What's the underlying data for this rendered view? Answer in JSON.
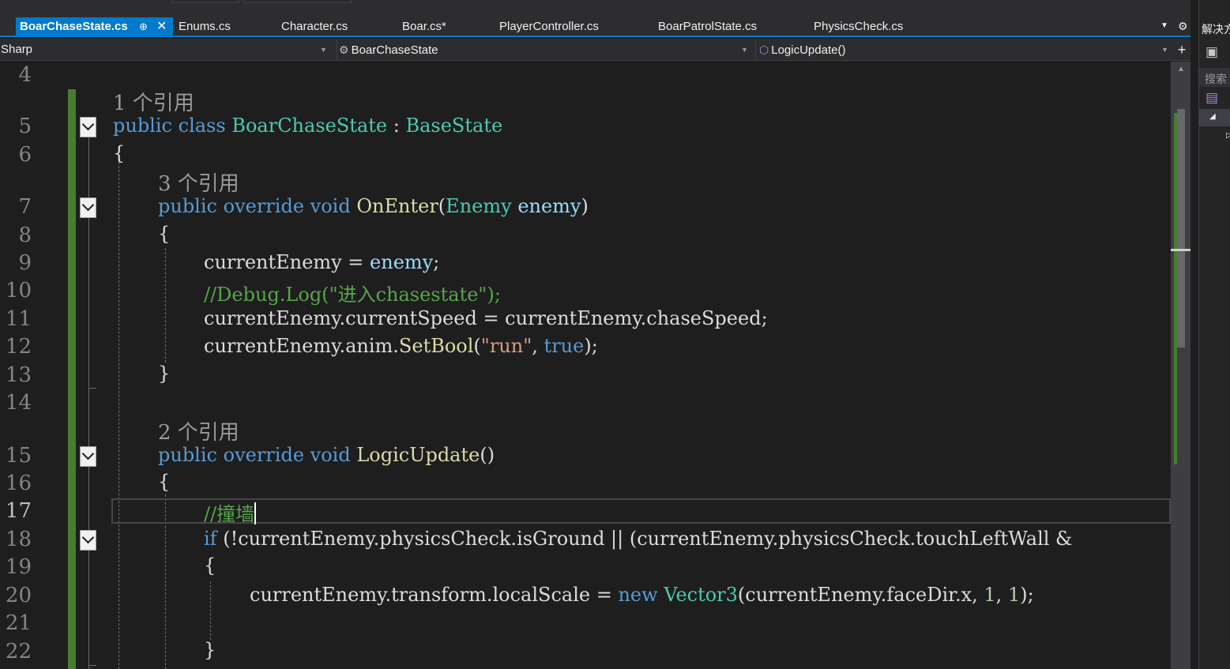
{
  "tabs": [
    {
      "label": "BoarChaseState.cs",
      "active": true
    },
    {
      "label": "Enums.cs"
    },
    {
      "label": "Character.cs"
    },
    {
      "label": "Boar.cs*"
    },
    {
      "label": "PlayerController.cs"
    },
    {
      "label": "BoarPatrolState.cs"
    },
    {
      "label": "PhysicsCheck.cs"
    }
  ],
  "tab_controls": {
    "pin": "⊕",
    "close": "✕",
    "dropdown": "▼",
    "gear": "⚙"
  },
  "navbar": {
    "project": "Sharp",
    "type": "BoarChaseState",
    "member": "LogicUpdate()",
    "split": "+"
  },
  "editor": {
    "line_numbers": [
      "4",
      "5",
      "6",
      "7",
      "8",
      "9",
      "10",
      "11",
      "12",
      "13",
      "14",
      "15",
      "16",
      "17",
      "18",
      "19",
      "20",
      "21",
      "22"
    ],
    "current_line": "17",
    "codelens": [
      "1 个引用",
      "3 个引用",
      "2 个引用"
    ],
    "code": {
      "l5": [
        "public",
        "class",
        "BoarChaseState",
        ":",
        "BaseState"
      ],
      "l6": "{",
      "l7": [
        "public",
        "override",
        "void",
        "OnEnter",
        "(",
        "Enemy",
        "enemy",
        ")"
      ],
      "l8": "{",
      "l9": [
        "currentEnemy",
        "=",
        "enemy",
        ";"
      ],
      "l10": "//Debug.Log(\"进入chasestate\");",
      "l11": "currentEnemy.currentSpeed = currentEnemy.chaseSpeed;",
      "l12": [
        "currentEnemy.anim.",
        "SetBool",
        "(",
        "\"run\"",
        ",",
        "true",
        ");"
      ],
      "l13": "}",
      "l15": [
        "public",
        "override",
        "void",
        "LogicUpdate",
        "()"
      ],
      "l16": "{",
      "l17": "//撞墙",
      "l18": [
        "if",
        "(!currentEnemy.physicsCheck.isGround || (currentEnemy.physicsCheck.touchLeftWall &"
      ],
      "l19": "{",
      "l20": [
        "currentEnemy.transform.localScale = ",
        "new",
        "Vector3",
        "(currentEnemy.faceDir.x, ",
        "1",
        ", ",
        "1",
        ");"
      ],
      "l22": "}"
    }
  },
  "right_panel": {
    "title": "解决方",
    "search": "搜索"
  },
  "colors": {
    "accent": "#007acc",
    "keyword": "#569cd6",
    "type": "#4ec9b0",
    "method": "#dcdcaa",
    "comment": "#57a64a",
    "string": "#d69d85",
    "change_bar": "#487c32"
  }
}
